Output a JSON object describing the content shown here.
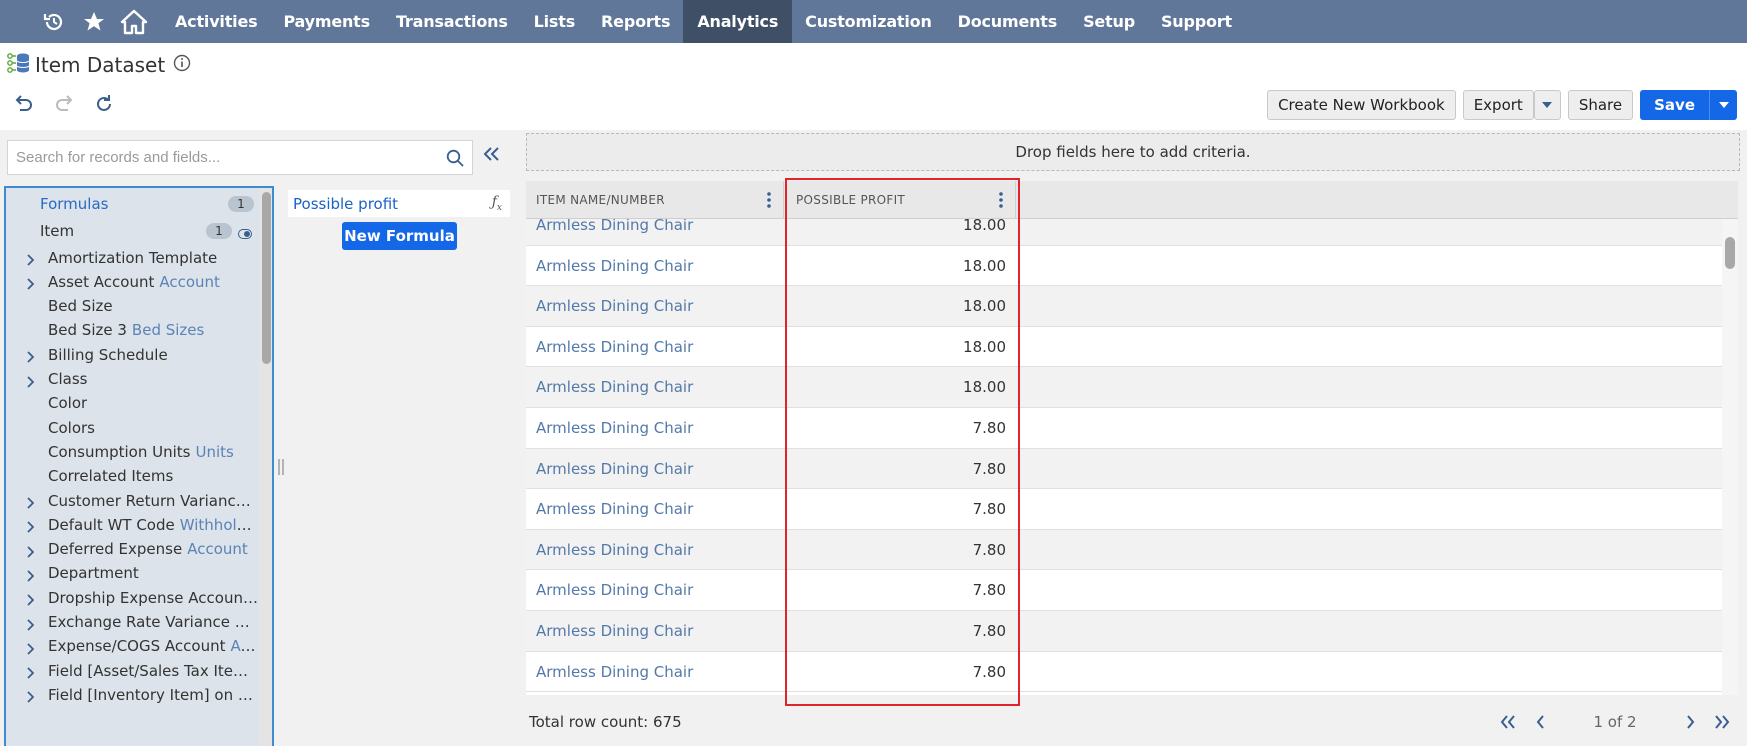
{
  "nav": {
    "items": [
      {
        "label": "Activities",
        "active": false
      },
      {
        "label": "Payments",
        "active": false
      },
      {
        "label": "Transactions",
        "active": false
      },
      {
        "label": "Lists",
        "active": false
      },
      {
        "label": "Reports",
        "active": false
      },
      {
        "label": "Analytics",
        "active": true
      },
      {
        "label": "Customization",
        "active": false
      },
      {
        "label": "Documents",
        "active": false
      },
      {
        "label": "Setup",
        "active": false
      },
      {
        "label": "Support",
        "active": false
      }
    ],
    "icons": [
      "history-icon",
      "star-icon",
      "home-icon"
    ]
  },
  "page": {
    "title": "Item Dataset"
  },
  "toolbar": {
    "create_workbook": "Create New Workbook",
    "export": "Export",
    "share": "Share",
    "save": "Save"
  },
  "search": {
    "placeholder": "Search for records and fields..."
  },
  "tree": {
    "formulas_label": "Formulas",
    "formulas_count": "1",
    "root_label": "Item",
    "root_count": "1",
    "items": [
      {
        "label": "Amortization Template",
        "sub": "",
        "expandable": true
      },
      {
        "label": "Asset Account",
        "sub": "Account",
        "expandable": true
      },
      {
        "label": "Bed Size",
        "sub": "",
        "expandable": false
      },
      {
        "label": "Bed Size 3",
        "sub": "Bed Sizes",
        "expandable": false
      },
      {
        "label": "Billing Schedule",
        "sub": "",
        "expandable": true
      },
      {
        "label": "Class",
        "sub": "",
        "expandable": true
      },
      {
        "label": "Color",
        "sub": "",
        "expandable": false
      },
      {
        "label": "Colors",
        "sub": "",
        "expandable": false
      },
      {
        "label": "Consumption Units",
        "sub": "Units",
        "expandable": false
      },
      {
        "label": "Correlated Items",
        "sub": "",
        "expandable": false
      },
      {
        "label": "Customer Return Variance A...",
        "sub": "",
        "expandable": true
      },
      {
        "label": "Default WT Code",
        "sub": "Withholdin...",
        "expandable": true
      },
      {
        "label": "Deferred Expense",
        "sub": "Account",
        "expandable": true
      },
      {
        "label": "Department",
        "sub": "",
        "expandable": true
      },
      {
        "label": "Dropship Expense Account",
        "sub": "A...",
        "expandable": true
      },
      {
        "label": "Exchange Rate Variance Acc...",
        "sub": "",
        "expandable": true
      },
      {
        "label": "Expense/COGS Account",
        "sub": "Acco...",
        "expandable": true
      },
      {
        "label": "Field [Asset/Sales Tax Item] ...",
        "sub": "",
        "expandable": true
      },
      {
        "label": "Field [Inventory Item] on [Pr...",
        "sub": "",
        "expandable": true
      }
    ]
  },
  "formulas_panel": {
    "item": "Possible profit",
    "new_button": "New Formula"
  },
  "grid": {
    "dropzone": "Drop fields here to add criteria.",
    "columns": [
      "ITEM NAME/NUMBER",
      "POSSIBLE PROFIT"
    ],
    "rows": [
      [
        "Armless Dining Chair",
        "18.00"
      ],
      [
        "Armless Dining Chair",
        "18.00"
      ],
      [
        "Armless Dining Chair",
        "18.00"
      ],
      [
        "Armless Dining Chair",
        "18.00"
      ],
      [
        "Armless Dining Chair",
        "18.00"
      ],
      [
        "Armless Dining Chair",
        "7.80"
      ],
      [
        "Armless Dining Chair",
        "7.80"
      ],
      [
        "Armless Dining Chair",
        "7.80"
      ],
      [
        "Armless Dining Chair",
        "7.80"
      ],
      [
        "Armless Dining Chair",
        "7.80"
      ],
      [
        "Armless Dining Chair",
        "7.80"
      ],
      [
        "Armless Dining Chair",
        "7.80"
      ]
    ]
  },
  "footer": {
    "total": "Total row count: 675",
    "page": "1 of 2"
  },
  "colors": {
    "nav_bg": "#607799",
    "nav_active": "#3e4f66",
    "primary": "#1467e6",
    "highlight": "#e0242b"
  }
}
